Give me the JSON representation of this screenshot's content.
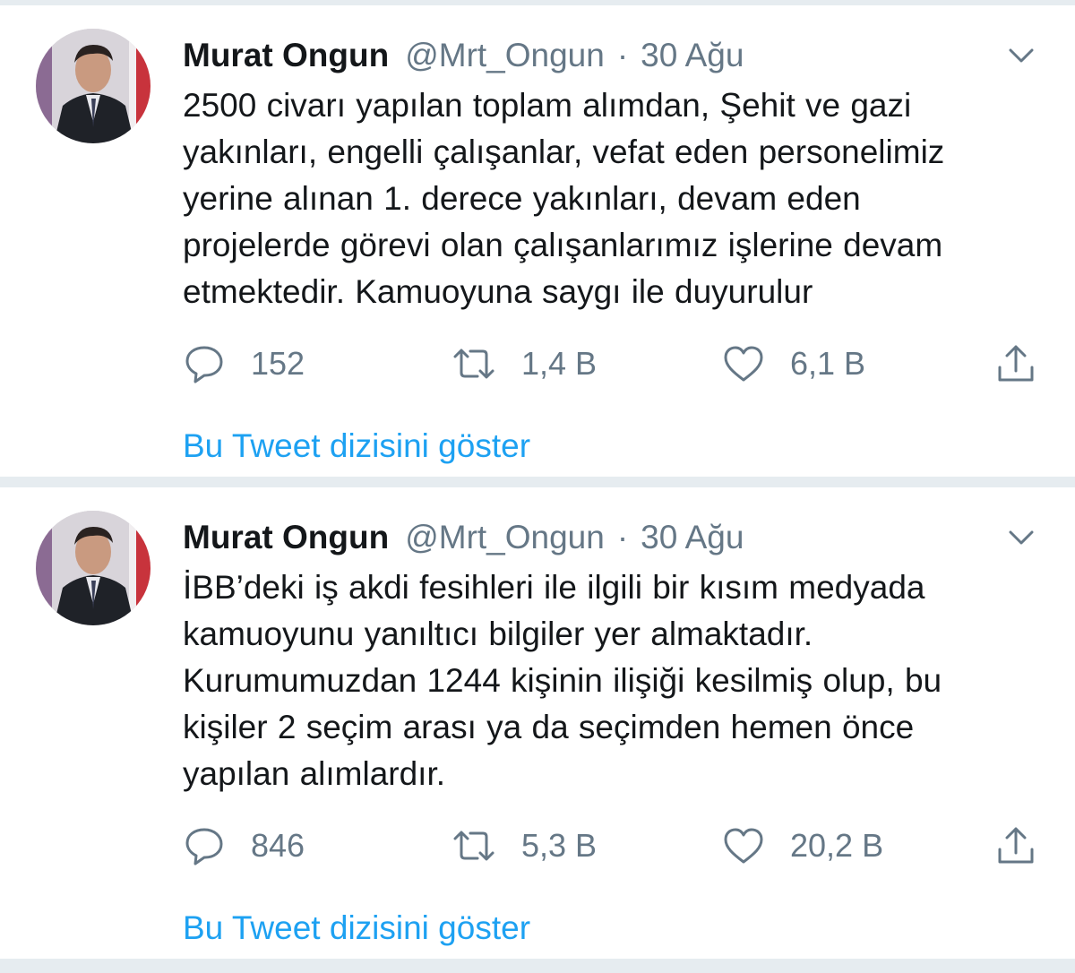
{
  "tweets": [
    {
      "author_name": "Murat Ongun",
      "handle": "@Mrt_Ongun",
      "separator": "·",
      "time": "30 Ağu",
      "text_lines": [
        "2500 civarı yapılan toplam alımdan, Şehit ve gazi",
        "yakınları, engelli çalışanlar, vefat eden personelimiz",
        "yerine alınan 1. derece yakınları, devam eden",
        "projelerde görevi olan çalışanlarımız işlerine devam",
        "etmektedir. Kamuoyuna saygı ile duyurulur"
      ],
      "replies": "152",
      "retweets": "1,4 B",
      "likes": "6,1 B",
      "thread_link": "Bu Tweet dizisini göster"
    },
    {
      "author_name": "Murat Ongun",
      "handle": "@Mrt_Ongun",
      "separator": "·",
      "time": "30 Ağu",
      "text_lines": [
        "İBB’deki iş akdi fesihleri ile ilgili bir kısım medyada",
        "kamuoyunu yanıltıcı bilgiler yer almaktadır.",
        "Kurumumuzdan 1244 kişinin ilişiği kesilmiş olup, bu",
        "kişiler 2 seçim arası ya da seçimden hemen önce",
        "yapılan alımlardır."
      ],
      "replies": "846",
      "retweets": "5,3 B",
      "likes": "20,2 B",
      "thread_link": "Bu Tweet dizisini göster"
    }
  ],
  "icons": {
    "reply": "reply-icon",
    "retweet": "retweet-icon",
    "like": "heart-icon",
    "share": "share-icon",
    "caret": "chevron-down-icon"
  },
  "colors": {
    "link": "#1da1f2",
    "secondary_text": "#657786",
    "primary_text": "#14171a",
    "divider": "#e6ecf0"
  }
}
